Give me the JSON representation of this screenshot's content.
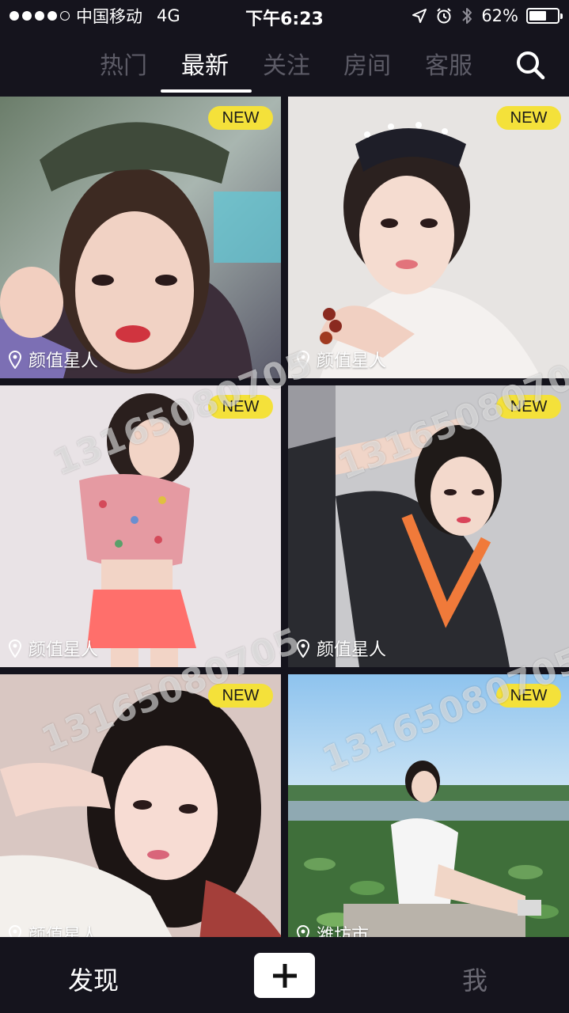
{
  "status_bar": {
    "carrier": "中国移动",
    "network": "4G",
    "time": "下午6:23",
    "battery_percent": "62%",
    "battery_level": 0.62,
    "signal_bars_filled": 4,
    "signal_bars_total": 5
  },
  "nav": {
    "tabs": [
      {
        "label": "热门"
      },
      {
        "label": "最新"
      },
      {
        "label": "关注"
      },
      {
        "label": "房间"
      },
      {
        "label": "客服"
      }
    ],
    "active_tab": "最新",
    "search_icon": "search-icon"
  },
  "feed": {
    "badge_label": "NEW",
    "watermark": "13165080705",
    "cards": [
      {
        "location": "颜值星人",
        "badge": "NEW"
      },
      {
        "location": "颜值星人",
        "badge": "NEW"
      },
      {
        "location": "颜值星人",
        "badge": "NEW"
      },
      {
        "location": "颜值星人",
        "badge": "NEW"
      },
      {
        "location": "颜值星人",
        "badge": "NEW"
      },
      {
        "location": "潍坊市",
        "badge": "NEW"
      }
    ]
  },
  "bottom_bar": {
    "discover_label": "发现",
    "add_icon": "plus-icon",
    "me_label": "我"
  },
  "colors": {
    "background": "#14131c",
    "badge": "#f4e13a",
    "tab_active": "#ffffff",
    "tab_inactive": "#5c5b66"
  }
}
